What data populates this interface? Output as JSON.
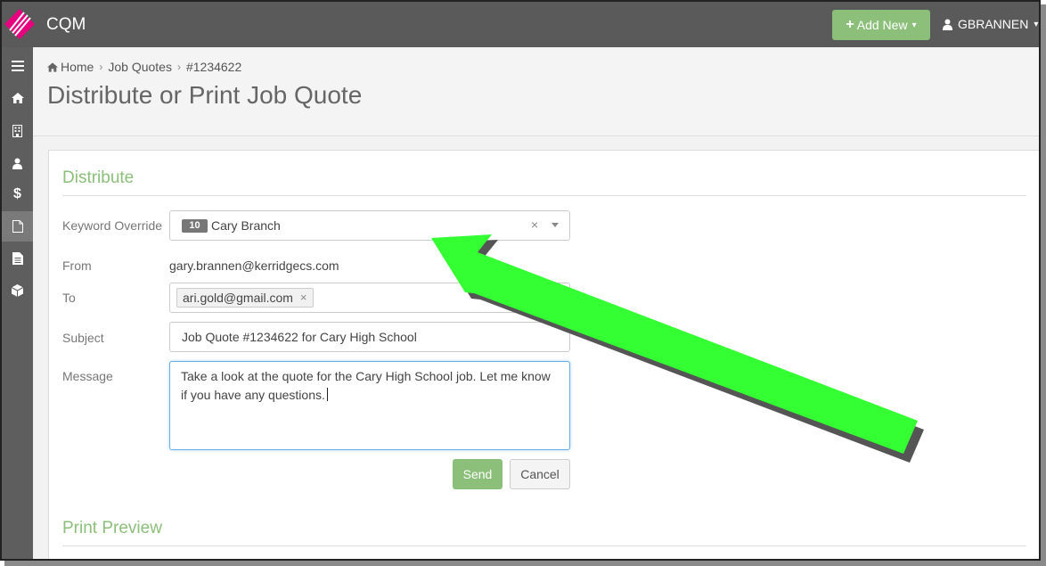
{
  "app": {
    "title": "CQM",
    "brand_color": "#e6007e",
    "accent": "#8bbf7a"
  },
  "header": {
    "add_new_label": "Add New",
    "user_name": "GBRANNEN"
  },
  "sidebar": {
    "items": [
      {
        "icon": "menu-icon"
      },
      {
        "icon": "home-icon"
      },
      {
        "icon": "building-icon"
      },
      {
        "icon": "user-icon"
      },
      {
        "icon": "dollar-icon"
      },
      {
        "icon": "file-icon",
        "active": true
      },
      {
        "icon": "file-text-icon"
      },
      {
        "icon": "cube-icon"
      }
    ]
  },
  "breadcrumb": {
    "home": "Home",
    "job_quotes": "Job Quotes",
    "current": "#1234622"
  },
  "page": {
    "title": "Distribute or Print Job Quote"
  },
  "distribute": {
    "section_title": "Distribute",
    "keyword": {
      "label": "Keyword Override",
      "badge": "10",
      "value": "Cary Branch"
    },
    "from": {
      "label": "From",
      "value": "gary.brannen@kerridgecs.com"
    },
    "to": {
      "label": "To",
      "tag": "ari.gold@gmail.com"
    },
    "subject": {
      "label": "Subject",
      "value": "Job Quote #1234622 for Cary High School"
    },
    "message": {
      "label": "Message",
      "value": "Take a look at the quote for the Cary High School job. Let me know if you have any questions."
    },
    "send_label": "Send",
    "cancel_label": "Cancel"
  },
  "print_preview": {
    "section_title": "Print Preview"
  },
  "annotation": {
    "arrow_color": "#33ff33"
  }
}
